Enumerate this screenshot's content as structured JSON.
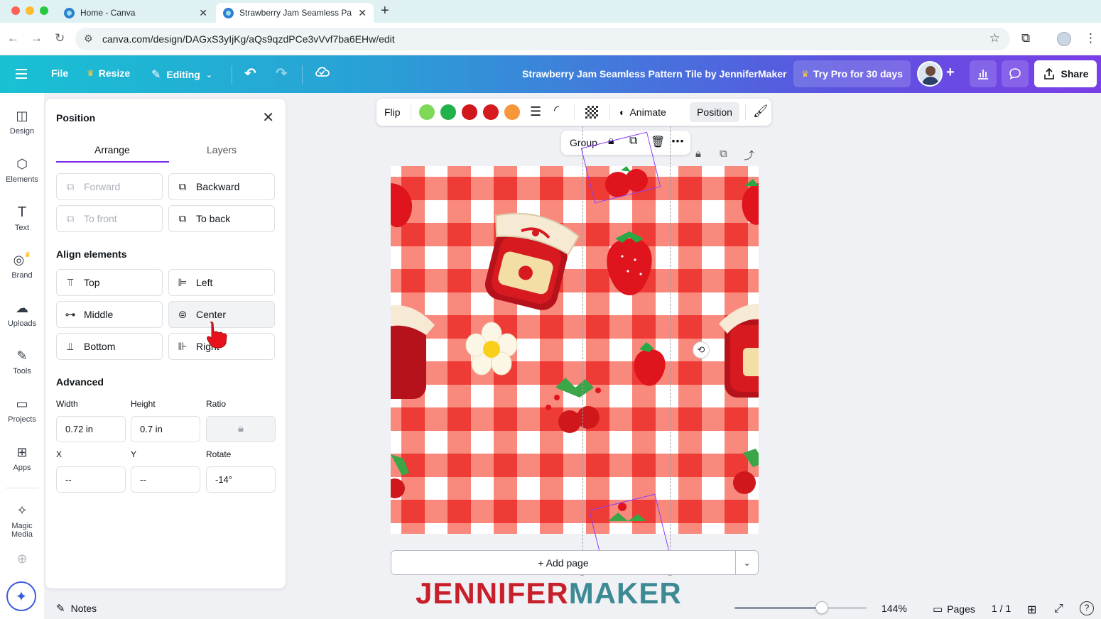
{
  "browser": {
    "tabs": [
      {
        "title": "Home - Canva"
      },
      {
        "title": "Strawberry Jam Seamless Pa"
      }
    ],
    "url": "canva.com/design/DAGxS3yIjKg/aQs9qzdPCe3vVvf7ba6EHw/edit"
  },
  "header": {
    "menu": {
      "file": "File",
      "resize": "Resize",
      "editing": "Editing"
    },
    "design_title": "Strawberry Jam Seamless Pattern Tile by JenniferMaker",
    "try_pro": "Try Pro for 30 days",
    "share": "Share"
  },
  "rail": [
    {
      "label": "Design",
      "icon": "design-icon"
    },
    {
      "label": "Elements",
      "icon": "elements-icon"
    },
    {
      "label": "Text",
      "icon": "text-icon"
    },
    {
      "label": "Brand",
      "icon": "brand-icon"
    },
    {
      "label": "Uploads",
      "icon": "uploads-icon"
    },
    {
      "label": "Tools",
      "icon": "tools-icon"
    },
    {
      "label": "Projects",
      "icon": "projects-icon"
    },
    {
      "label": "Apps",
      "icon": "apps-icon"
    },
    {
      "label": "Magic Media",
      "icon": "magic-media-icon"
    }
  ],
  "panel": {
    "title": "Position",
    "tabs": {
      "arrange": "Arrange",
      "layers": "Layers"
    },
    "order": {
      "forward": "Forward",
      "backward": "Backward",
      "to_front": "To front",
      "to_back": "To back"
    },
    "align_heading": "Align elements",
    "align": {
      "top": "Top",
      "left": "Left",
      "middle": "Middle",
      "center": "Center",
      "bottom": "Bottom",
      "right": "Right"
    },
    "advanced_heading": "Advanced",
    "labels": {
      "width": "Width",
      "height": "Height",
      "ratio": "Ratio",
      "x": "X",
      "y": "Y",
      "rotate": "Rotate"
    },
    "values": {
      "width": "0.72 in",
      "height": "0.7 in",
      "x": "--",
      "y": "--",
      "rotate": "-14°"
    }
  },
  "toolbar": {
    "flip": "Flip",
    "colors": [
      "#7ed957",
      "#22b24c",
      "#d0171b",
      "#d71920",
      "#f7963a"
    ],
    "animate": "Animate",
    "position": "Position"
  },
  "group_bar": {
    "group": "Group"
  },
  "canvas": {
    "add_page": "+ Add page",
    "palette": {
      "red": "#ee3b35",
      "light_red": "#f8897c",
      "white": "#ffffff"
    }
  },
  "logo": {
    "part1": "JENNIFER",
    "part2": "MAKER",
    "color1": "#c8202a",
    "color2": "#3d8a95"
  },
  "bottom": {
    "notes": "Notes",
    "zoom": "144%",
    "zoom_fraction": 0.66,
    "pages": "Pages",
    "page_count": "1 / 1"
  }
}
